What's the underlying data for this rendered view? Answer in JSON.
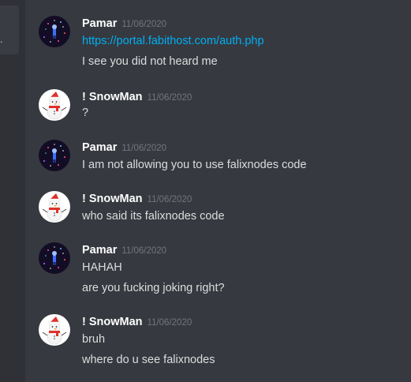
{
  "sidebar": {
    "selected_marker": "."
  },
  "users": {
    "pamar": {
      "name": "Pamar",
      "avatar_icon": "galaxy-avatar-icon"
    },
    "snowman": {
      "name": "! SnowMan",
      "avatar_icon": "snowman-avatar-icon"
    }
  },
  "messages": [
    {
      "author": "Pamar",
      "timestamp": "11/06/2020",
      "lines": [
        "https://portal.fabithost.com/auth.php",
        "I see you did not heard me"
      ]
    },
    {
      "author": "! SnowMan",
      "timestamp": "11/06/2020",
      "lines": [
        "?"
      ]
    },
    {
      "author": "Pamar",
      "timestamp": "11/06/2020",
      "lines": [
        "I am not allowing you to use falixnodes code"
      ]
    },
    {
      "author": "! SnowMan",
      "timestamp": "11/06/2020",
      "lines": [
        "who said its falixnodes code"
      ]
    },
    {
      "author": "Pamar",
      "timestamp": "11/06/2020",
      "lines": [
        "HAHAH",
        "are you fucking joking right?"
      ]
    },
    {
      "author": "! SnowMan",
      "timestamp": "11/06/2020",
      "lines": [
        "bruh",
        "where do u see falixnodes"
      ]
    }
  ],
  "colors": {
    "background": "#36393f",
    "sidebar": "#2f3136",
    "text": "#dcddde",
    "username": "#ffffff",
    "timestamp": "#72767d",
    "link": "#00aff4"
  }
}
